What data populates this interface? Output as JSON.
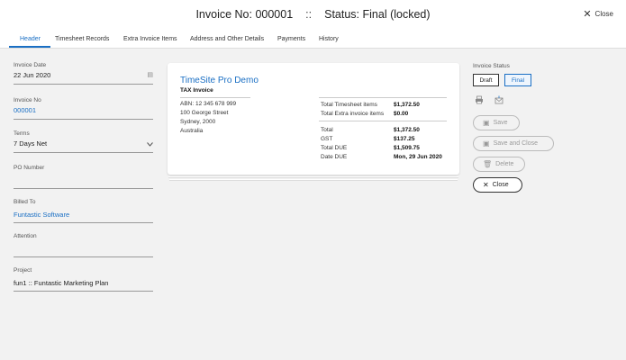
{
  "header": {
    "invoice_no_text": "Invoice No: 000001",
    "separator": "::",
    "status_text": "Status: Final (locked)",
    "close_label": "Close"
  },
  "tabs": [
    {
      "label": "Header"
    },
    {
      "label": "Timesheet Records"
    },
    {
      "label": "Extra Invoice Items"
    },
    {
      "label": "Address and Other Details"
    },
    {
      "label": "Payments"
    },
    {
      "label": "History"
    }
  ],
  "form": {
    "invoice_date": {
      "label": "Invoice Date",
      "value": "22 Jun 2020"
    },
    "invoice_no": {
      "label": "Invoice No",
      "value": "000001"
    },
    "terms": {
      "label": "Terms",
      "value": "7 Days Net"
    },
    "po_number": {
      "label": "PO Number",
      "value": ""
    },
    "billed_to": {
      "label": "Billed To",
      "value": "Funtastic Software"
    },
    "attention": {
      "label": "Attention",
      "value": ""
    },
    "project": {
      "label": "Project",
      "value": "fun1 :: Funtastic Marketing Plan"
    }
  },
  "preview": {
    "company": "TimeSite Pro Demo",
    "doc_type": "TAX Invoice",
    "address": [
      "ABN: 12 345 678 999",
      "100 George Street",
      "Sydney, 2000",
      "Australia"
    ],
    "summary": [
      {
        "label": "Total Timesheet items",
        "value": "$1,372.50"
      },
      {
        "label": "Total Extra invoice items",
        "value": "$0.00"
      },
      {
        "label": "Total",
        "value": "$1,372.50"
      },
      {
        "label": "GST",
        "value": "$137.25"
      },
      {
        "label": "Total DUE",
        "value": "$1,509.75"
      },
      {
        "label": "Date DUE",
        "value": "Mon, 29 Jun 2020"
      }
    ]
  },
  "status_panel": {
    "label": "Invoice Status",
    "draft_label": "Draft",
    "final_label": "Final",
    "save_label": "Save",
    "save_close_label": "Save and Close",
    "delete_label": "Delete",
    "close_label": "Close"
  },
  "colors": {
    "accent": "#1a6fc4",
    "background": "#f2f2f2"
  }
}
